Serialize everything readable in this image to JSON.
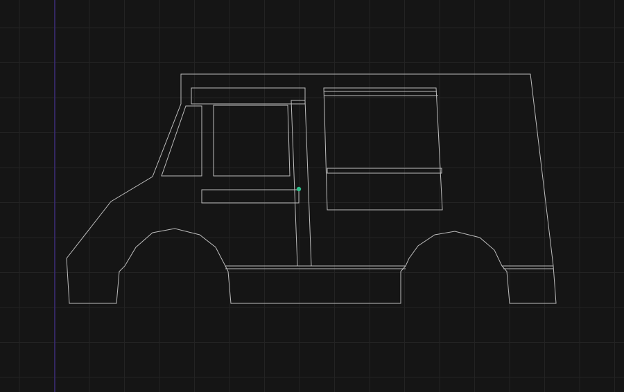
{
  "app": {
    "background_color": "#151515",
    "grid_color": "#232323",
    "axis_color": "#3a2a78",
    "stroke_color": "#bdbdbd",
    "snap_point_color": "#2bbf8a"
  },
  "drawing": {
    "subject": "food-truck-outline",
    "parts": [
      "body-outline",
      "roof-panel",
      "windshield",
      "door-window",
      "door-frame",
      "door-handle",
      "serving-window",
      "serving-window-awning",
      "serving-window-counter",
      "rear-bumper",
      "front-wheel-arch",
      "rear-wheel-arch",
      "skirt-line"
    ],
    "snap_point": {
      "visible": true
    }
  }
}
